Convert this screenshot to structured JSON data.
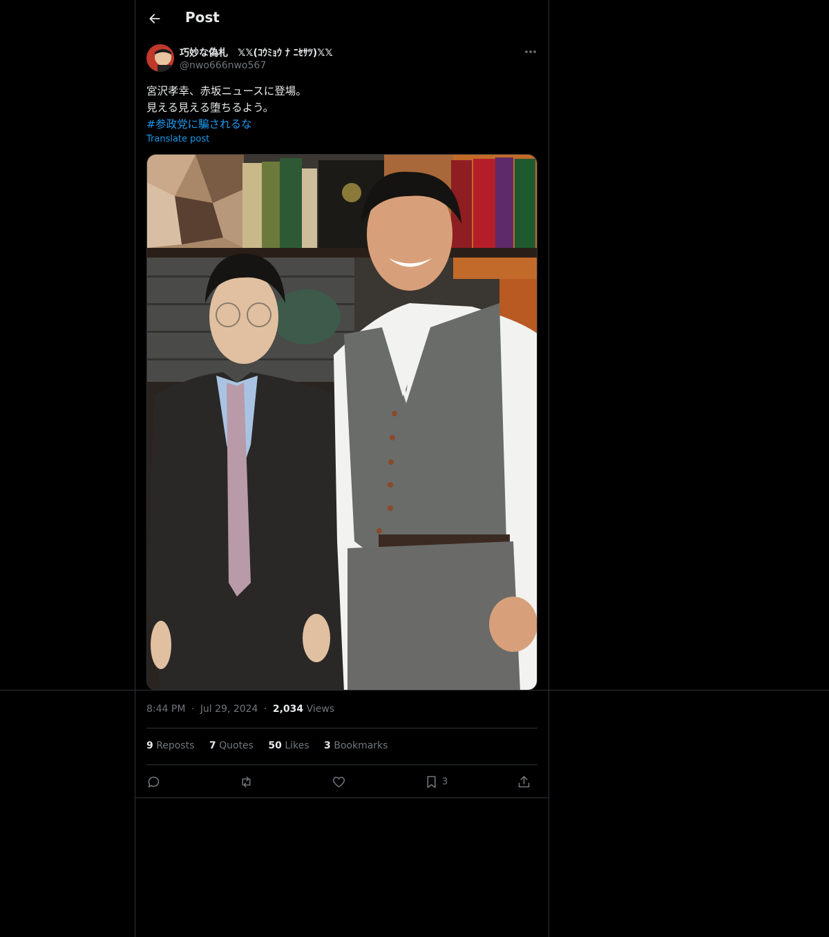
{
  "header": {
    "title": "Post"
  },
  "author": {
    "name": "巧妙な偽札　𝕏𝕏(ｺｳﾐｮｳ ﾅ ﾆｾｻﾂ)𝕏𝕏",
    "handle": "@nwo666nwo567"
  },
  "post": {
    "line1": "宮沢孝幸、赤坂ニュースに登場。",
    "line2": "見える見える堕ちるよう。",
    "hashtag": "#参政党に騙されるな",
    "translate_label": "Translate post"
  },
  "meta": {
    "time": "8:44 PM",
    "sep1": "·",
    "date": "Jul 29, 2024",
    "sep2": "·",
    "views_count": "2,034",
    "views_label": "Views"
  },
  "stats": {
    "reposts_count": "9",
    "reposts_label": "Reposts",
    "quotes_count": "7",
    "quotes_label": "Quotes",
    "likes_count": "50",
    "likes_label": "Likes",
    "bookmarks_count": "3",
    "bookmarks_label": "Bookmarks"
  },
  "actions": {
    "bookmark_count": "3",
    "icons": [
      "reply-icon",
      "repost-icon",
      "like-icon",
      "bookmark-icon",
      "share-icon"
    ]
  },
  "colors": {
    "background": "#000000",
    "text": "#e7e9ea",
    "muted": "#71767b",
    "accent": "#1d9bf0",
    "border": "#2f3336"
  }
}
